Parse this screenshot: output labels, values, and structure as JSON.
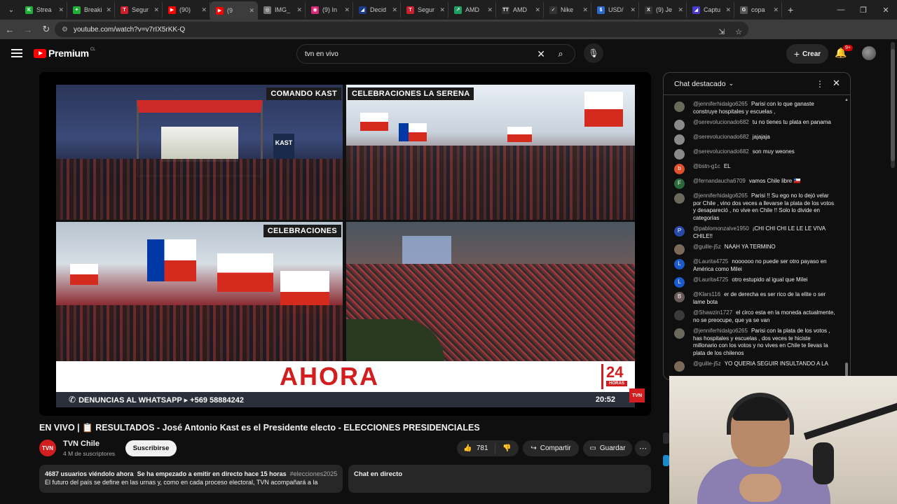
{
  "browser": {
    "tabs": [
      {
        "label": "Strea",
        "color": "#20b038",
        "glyph": "K"
      },
      {
        "label": "Breaki",
        "color": "#20b038",
        "glyph": "✦"
      },
      {
        "label": "Segur",
        "color": "#cc1f2c",
        "glyph": "T"
      },
      {
        "label": "(90) ",
        "color": "#ff0000",
        "glyph": "▶"
      },
      {
        "label": "(9",
        "color": "#ff0000",
        "glyph": "▶",
        "active": true
      },
      {
        "label": "IMG_",
        "color": "#777777",
        "glyph": "◎"
      },
      {
        "label": "(9) In",
        "color": "#d62976",
        "glyph": "◉"
      },
      {
        "label": "Decid",
        "color": "#1a3a8a",
        "glyph": "◢"
      },
      {
        "label": "Segur",
        "color": "#cc1f2c",
        "glyph": "T"
      },
      {
        "label": "AMD",
        "color": "#20a060",
        "glyph": "↗"
      },
      {
        "label": "AMD",
        "color": "#333333",
        "glyph": "TT"
      },
      {
        "label": "Nike",
        "color": "#333333",
        "glyph": "✓"
      },
      {
        "label": "USD/",
        "color": "#2a6acc",
        "glyph": "$"
      },
      {
        "label": "(9) Je",
        "color": "#333333",
        "glyph": "X"
      },
      {
        "label": "Captu",
        "color": "#4a3acc",
        "glyph": "◢"
      },
      {
        "label": "copa",
        "color": "#555555",
        "glyph": "G"
      }
    ],
    "new_tab": "+",
    "url": "youtube.com/watch?v=v7rIX5rKK-Q"
  },
  "youtube": {
    "logo": "Premium",
    "country": "CL",
    "search_query": "tvn en vivo",
    "create_label": "Crear",
    "notif_badge": "9+"
  },
  "player": {
    "quadrant_labels": [
      "COMANDO KAST",
      "CELEBRACIONES LA SERENA",
      "CELEBRACIONES"
    ],
    "stage_sign": "KAST",
    "ahora": "AHORA",
    "logo24_num": "24",
    "logo24_sub": "HORAS",
    "ticker": "DENUNCIAS AL WHATSAPP ▸ +569 58884242",
    "time": "20:52",
    "bug": "TVN"
  },
  "video": {
    "title": "EN VIVO | 📋 RESULTADOS - José Antonio Kast es el Presidente electo - ELECCIONES PRESIDENCIALES",
    "channel": "TVN Chile",
    "channel_avatar": "TVN",
    "subs": "4 M de suscriptores",
    "subscribe": "Suscribirse",
    "likes": "781",
    "share": "Compartir",
    "save": "Guardar",
    "meta_viewers": "4687 usuarios viéndolo ahora",
    "meta_started": "Se ha empezado a emitir en directo hace 15 horas",
    "meta_tag": "#elecciones2025",
    "description": "El futuro del país se define en las urnas y, como en cada proceso electoral, TVN acompañará a la",
    "chat_direct": "Chat en directo"
  },
  "chat": {
    "title": "Chat destacado",
    "messages": [
      {
        "author": "@jenniferhidalgo6265",
        "text": "Parisi con lo que ganaste construye hospitales y escuelas ,",
        "av": "#6a6a5a",
        "ini": ""
      },
      {
        "author": "@serevolucionado682",
        "text": "tu no tienes tu plata en panama",
        "av": "#8a8a8a",
        "ini": ""
      },
      {
        "author": "@serevolucionado682",
        "text": "jajajaja",
        "av": "#8a8a8a",
        "ini": ""
      },
      {
        "author": "@serevolucionado682",
        "text": "son muy weones",
        "av": "#8a8a8a",
        "ini": ""
      },
      {
        "author": "@bstn-g1c",
        "text": "EL",
        "av": "#e0502a",
        "ini": "b"
      },
      {
        "author": "@fernandaucha6709",
        "text": "vamos Chile libre 🇨🇱",
        "av": "#2a6a3a",
        "ini": "F"
      },
      {
        "author": "@jenniferhidalgo6265",
        "text": "Parisi !! Su ego no lo dejó velar por Chile , vino dos veces a llevarse la plata de los votos y desapareció , no vive en Chile !! Solo lo divide en categorías",
        "av": "#6a6a5a",
        "ini": ""
      },
      {
        "author": "@pablomonzalve1950",
        "text": "¡CHI CHI CHI LE LE LE VIVA CHILE!!",
        "av": "#2a4aaa",
        "ini": "P"
      },
      {
        "author": "@guille-j5z",
        "text": "NAAH YA TERMINO",
        "av": "#7a6a5a",
        "ini": ""
      },
      {
        "author": "@Laurita4725",
        "text": "noooooo no puede ser otro payaso en América como Milei",
        "av": "#1a5acc",
        "ini": "L"
      },
      {
        "author": "@Laurita4725",
        "text": "otro estupido al igual que Milei",
        "av": "#1a5acc",
        "ini": "L"
      },
      {
        "author": "@Klars116",
        "text": "er de derecha es ser rico de la elite o ser lame bota",
        "av": "#6a5a5a",
        "ini": "B"
      },
      {
        "author": "@Shawzin1727",
        "text": "el circo esta en la moneda actualmente, no se preocupe, que ya se van",
        "av": "#3a3a3a",
        "ini": ""
      },
      {
        "author": "@jenniferhidalgo6265",
        "text": "Parisi con la plata de los votos , has hospitales y escuelas , dos veces te hiciste millonario con los votos y no vives en Chile te llevas la plata de los chilenos",
        "av": "#6a6a5a",
        "ini": ""
      },
      {
        "author": "@guille-j5z",
        "text": "YO QUERIA SEGUIR INSULTANDO A LA",
        "av": "#7a6a5a",
        "ini": ""
      }
    ]
  },
  "colors": {
    "accent": "#ff0000",
    "tvn_red": "#d21e1e",
    "bg": "#0f0f0f"
  }
}
